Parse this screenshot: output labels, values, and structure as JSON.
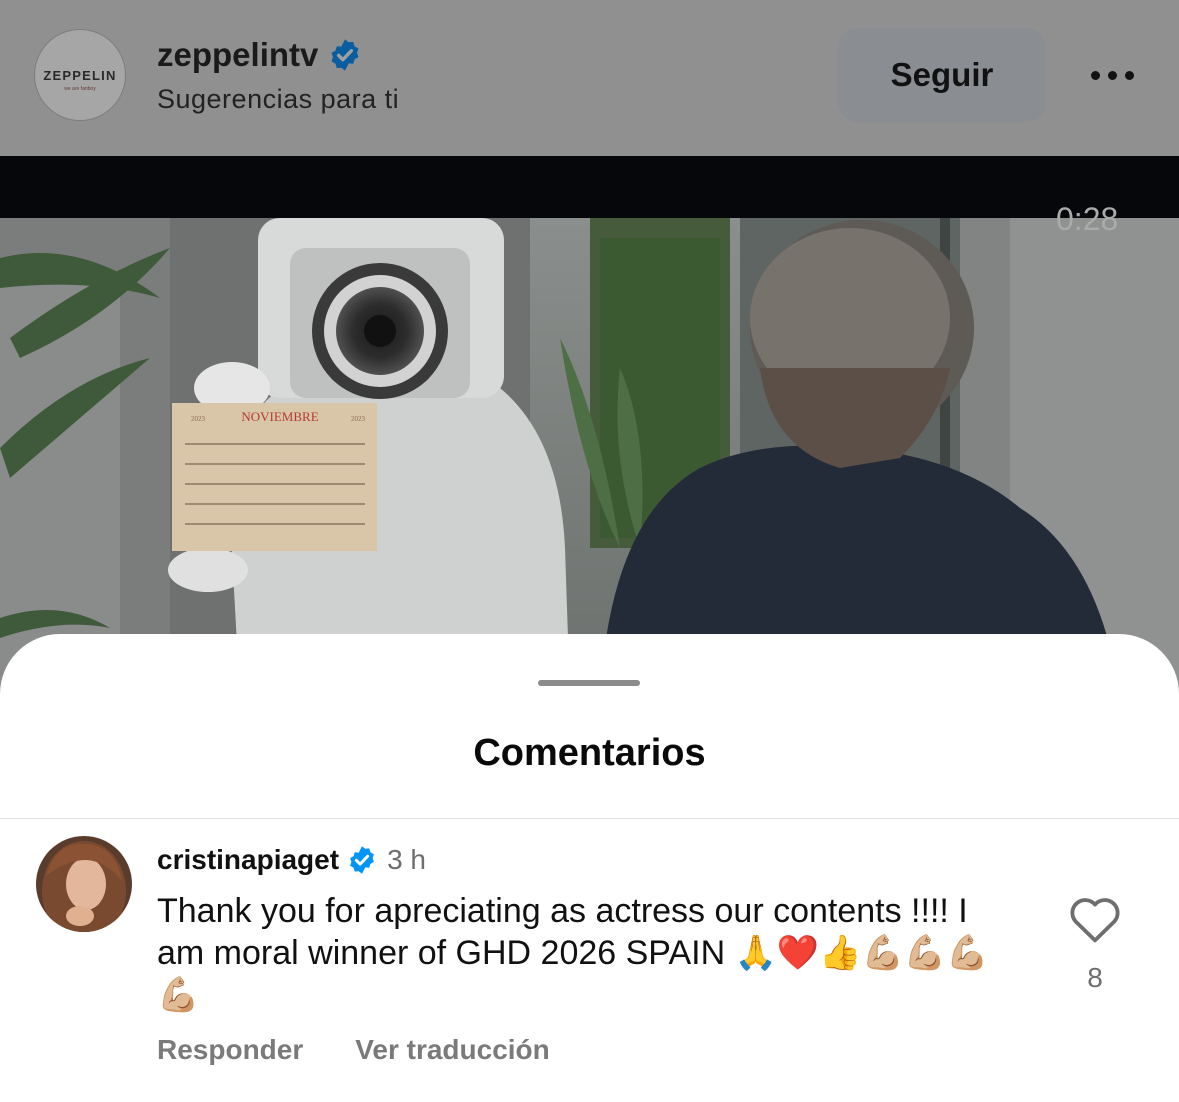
{
  "header": {
    "avatar_text": "ZEPPELIN",
    "avatar_subtext": "we are fanboy",
    "username": "zeppelintv",
    "subtitle": "Sugerencias para ti",
    "follow_label": "Seguir"
  },
  "video": {
    "time": "0:28",
    "calendar_month": "NOVIEMBRE",
    "calendar_year": "2023"
  },
  "comments_sheet": {
    "title": "Comentarios",
    "comment": {
      "username": "cristinapiaget",
      "time": "3 h",
      "text": "Thank you for apreciating as actress our contents !!!! I am moral winner of GHD 2026 SPAIN 🙏❤️👍💪🏼💪🏼💪🏼💪🏼",
      "reply_label": "Responder",
      "translate_label": "Ver traducción",
      "like_count": "8"
    }
  },
  "colors": {
    "verified_blue": "#0095f6",
    "overlay_gray": "#909090"
  }
}
